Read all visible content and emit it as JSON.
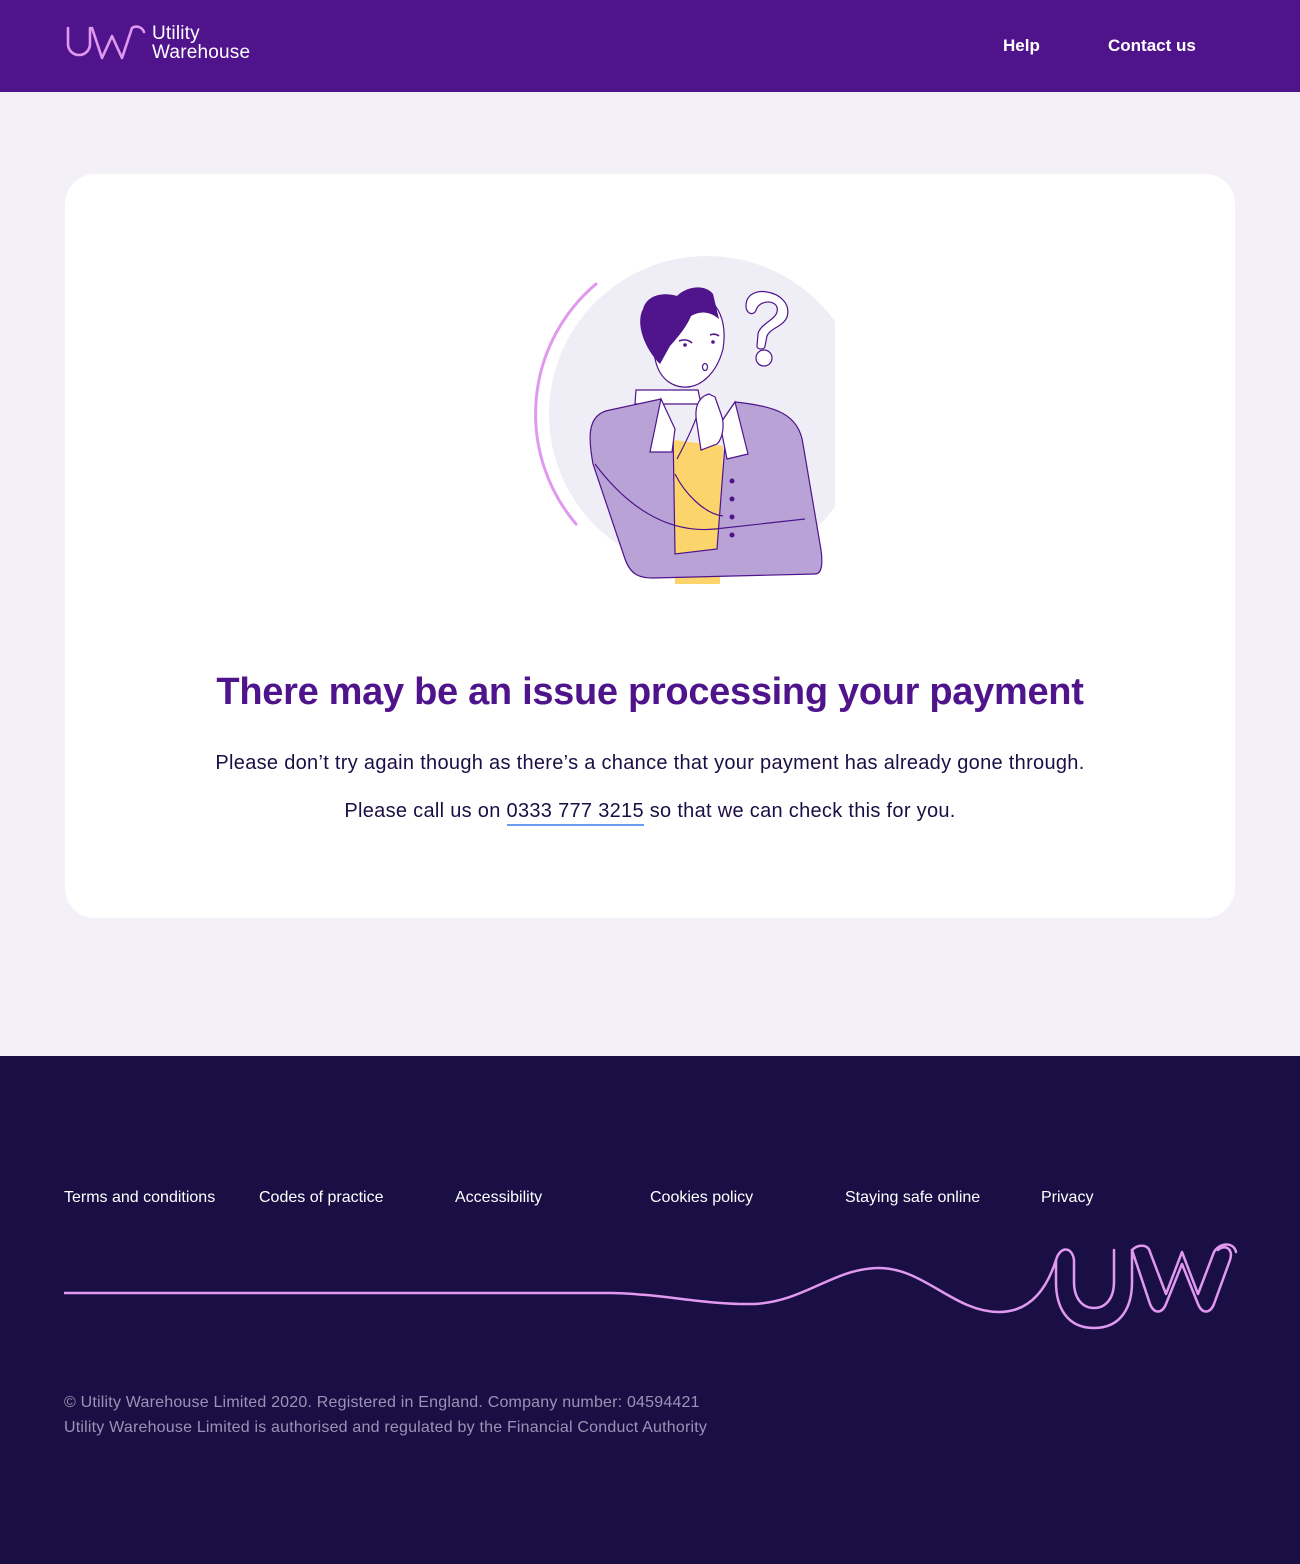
{
  "header": {
    "logo_line1": "Utility",
    "logo_line2": "Warehouse",
    "nav": {
      "help_label": "Help",
      "contact_label": "Contact us"
    }
  },
  "main": {
    "headline": "There may be an issue processing your payment",
    "message": "Please don’t try again though as there’s a chance that your payment has already gone through.",
    "call_prefix": "Please call us on",
    "phone": "0333 777 3215",
    "call_suffix": "so that we can check this for you."
  },
  "footer": {
    "links": [
      "Terms and conditions",
      "Codes of practice",
      "Accessibility",
      "Cookies policy",
      "Staying safe online",
      "Privacy"
    ],
    "legal_line1": "© Utility Warehouse Limited 2020. Registered in England. Company number: 04594421",
    "legal_line2": "Utility Warehouse Limited is authorised and regulated by the Financial Conduct Authority"
  },
  "colors": {
    "brand_purple": "#4f148c",
    "footer_navy": "#1a0f45",
    "accent_pink": "#e199ef",
    "page_background": "#f3f1f7",
    "link_underline": "#6b9cf2"
  },
  "icons": {
    "logo": "uw-logo-icon",
    "illustration": "thinking-person-illustration",
    "footer_mark": "uw-wave-logo-icon"
  }
}
